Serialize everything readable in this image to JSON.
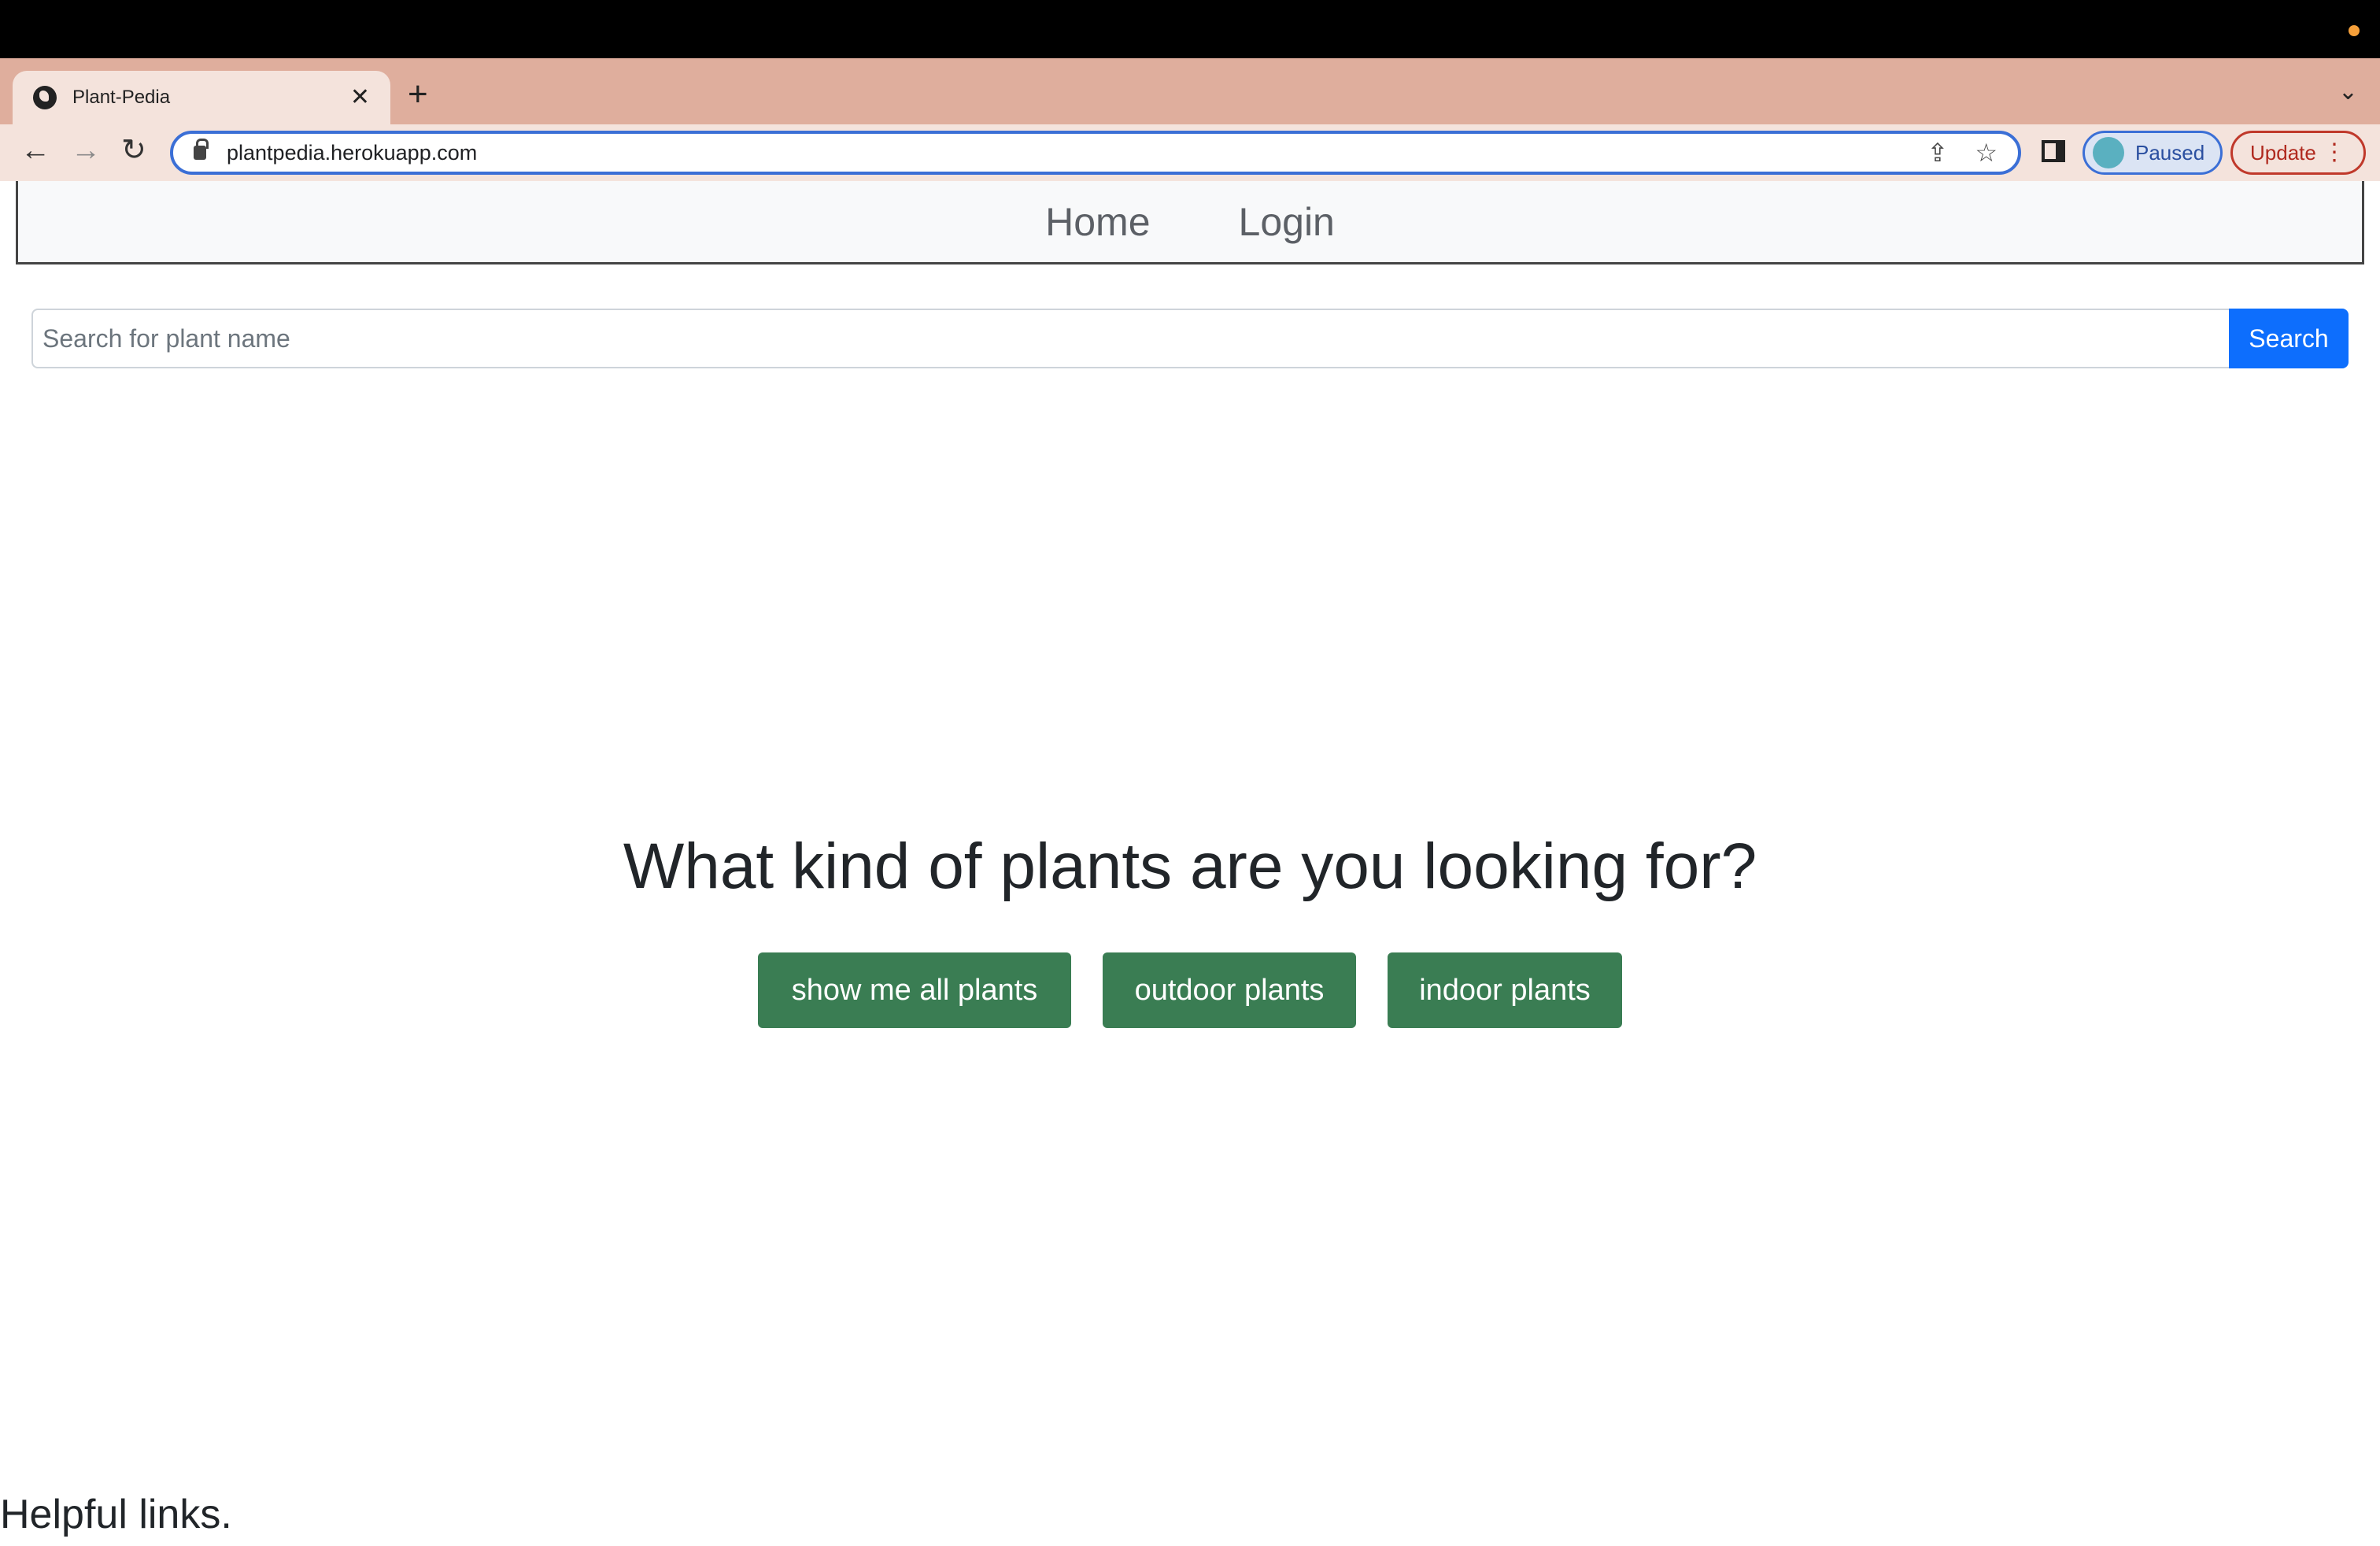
{
  "browser": {
    "tab_title": "Plant-Pedia",
    "tab_close": "✕",
    "new_tab": "+",
    "tab_menu": "⌄",
    "url": "plantpedia.herokuapp.com",
    "back": "←",
    "forward": "→",
    "reload": "↻",
    "share": "⇪",
    "bookmark": "☆",
    "profile_status": "Paused",
    "update_label": "Update",
    "menu": "⋮"
  },
  "nav": {
    "home": "Home",
    "login": "Login"
  },
  "search": {
    "placeholder": "Search for plant name",
    "button": "Search"
  },
  "hero": {
    "heading": "What kind of plants are you looking for?",
    "buttons": [
      "show me all plants",
      "outdoor plants",
      "indoor plants"
    ]
  },
  "footer": {
    "text": "Helpful links."
  },
  "colors": {
    "primary": "#0d6efd",
    "plant_button": "#3a7d53",
    "tab_strip": "#dfae9d"
  }
}
